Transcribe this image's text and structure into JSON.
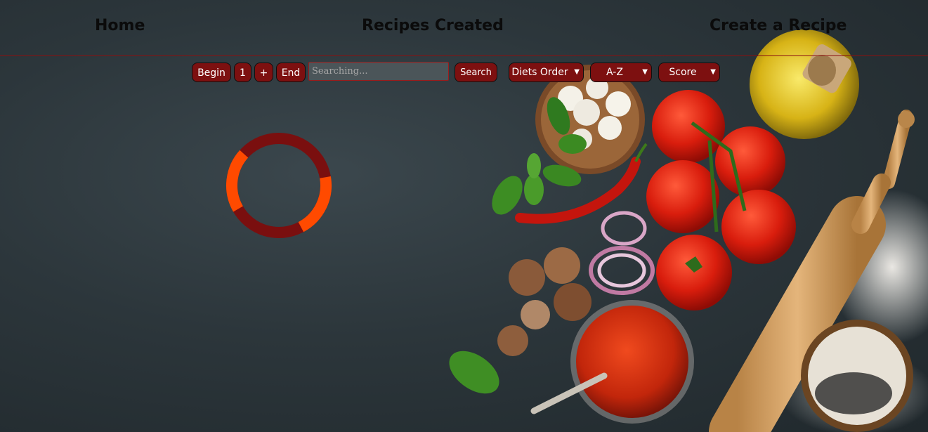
{
  "nav": {
    "home": "Home",
    "recipes_created": "Recipes Created",
    "create_recipe": "Create a Recipe"
  },
  "toolbar": {
    "begin": "Begin",
    "page": "1",
    "next": "+",
    "end": "End",
    "search_placeholder": "Searching...",
    "search_button": "Search",
    "diets_select": "Diets Order",
    "alpha_select": "A-Z",
    "score_select": "Score"
  },
  "colors": {
    "accent": "#7d1010",
    "spinner_dark": "#7a0f0f",
    "spinner_light": "#ff4a00"
  },
  "icons": {
    "loading": "loading-spinner-icon",
    "chevron": "chevron-down-icon"
  }
}
